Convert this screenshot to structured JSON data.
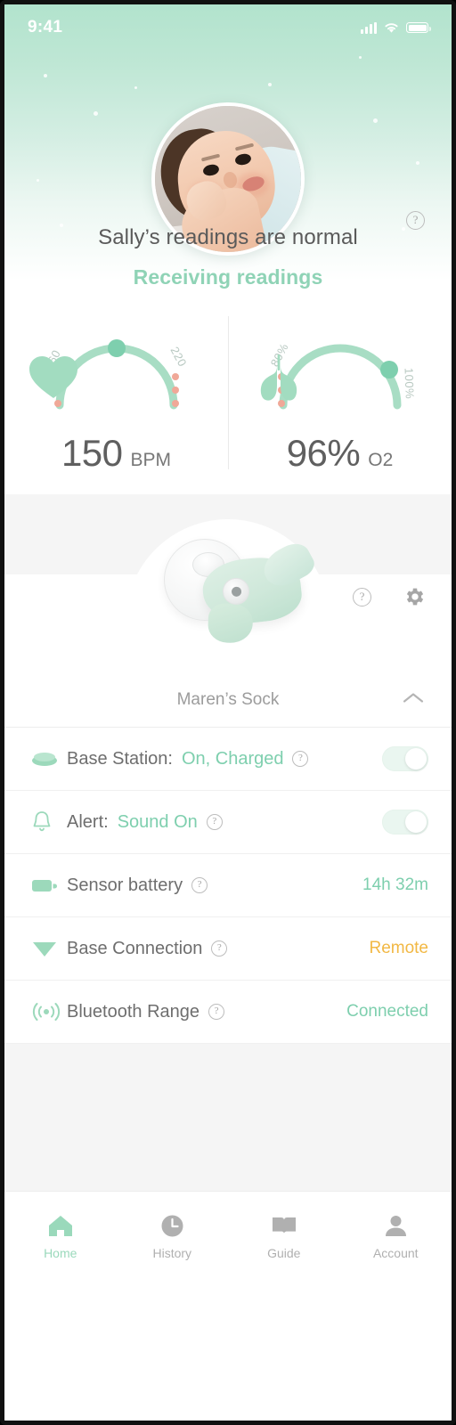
{
  "statusbar": {
    "time": "9:41",
    "signal_icon": "cellular-signal-icon",
    "wifi_icon": "wifi-icon",
    "battery_icon": "battery-icon"
  },
  "header": {
    "avatar_alt": "baby-photo",
    "status_line": "Sally’s  readings are normal",
    "connection_state": "Receiving readings",
    "help_icon": "help-icon",
    "accent_color": "#8fd3b6",
    "background_start": "#b2e3cd"
  },
  "vitals": [
    {
      "id": "heart-rate",
      "icon": "heart-icon",
      "value": "150",
      "unit": "BPM",
      "min_label": "60",
      "max_label": "220",
      "arc_color": "#a8ddc4",
      "marker_color": "#7ecfae",
      "marker_position_pct": 50,
      "alarm_dots": 3,
      "alarm_dot_color": "#f0a898",
      "alarm_dots_left": true,
      "alarm_dots_right": true
    },
    {
      "id": "oxygen",
      "icon": "lungs-icon",
      "value": "96%",
      "unit": "O2",
      "min_label": "80%",
      "max_label": "100%",
      "arc_color": "#a8ddc4",
      "marker_color": "#7ecfae",
      "marker_position_pct": 80,
      "alarm_dots": 3,
      "alarm_dot_color": "#f0a898",
      "alarm_dots_left": true,
      "alarm_dots_right": false
    }
  ],
  "device": {
    "photo_alt": "sock-sensor-and-base-station",
    "help_icon": "help-icon",
    "settings_icon": "gear-icon",
    "name": "Maren’s Sock",
    "collapse_icon": "chevron-up-icon"
  },
  "status_rows": [
    {
      "icon": "base-station-icon",
      "label": "Base Station:",
      "inline_value": "On, Charged",
      "help_icon": "help-icon",
      "control": "toggle",
      "toggle_on": true
    },
    {
      "icon": "bell-icon",
      "label": "Alert:",
      "inline_value": "Sound On",
      "help_icon": "help-icon",
      "control": "toggle",
      "toggle_on": true
    },
    {
      "icon": "battery-icon",
      "label": "Sensor battery",
      "inline_value": "",
      "help_icon": "help-icon",
      "control": "value",
      "value": "14h 32m",
      "value_color": "mint"
    },
    {
      "icon": "wifi-signal-icon",
      "label": "Base Connection",
      "inline_value": "",
      "help_icon": "help-icon",
      "control": "value",
      "value": "Remote",
      "value_color": "amber"
    },
    {
      "icon": "bluetooth-range-icon",
      "label": "Bluetooth Range",
      "inline_value": "",
      "help_icon": "help-icon",
      "control": "value",
      "value": "Connected",
      "value_color": "mint"
    }
  ],
  "tabs": [
    {
      "label": "Home",
      "icon": "home-icon",
      "active": true
    },
    {
      "label": "History",
      "icon": "clock-icon",
      "active": false
    },
    {
      "label": "Guide",
      "icon": "book-icon",
      "active": false
    },
    {
      "label": "Account",
      "icon": "person-icon",
      "active": false
    }
  ],
  "colors": {
    "mint": "#7ecfae",
    "mint_light": "#a8ddc4",
    "amber": "#f2b844",
    "coral": "#f0a898",
    "gray_text": "#6e6e6e"
  }
}
